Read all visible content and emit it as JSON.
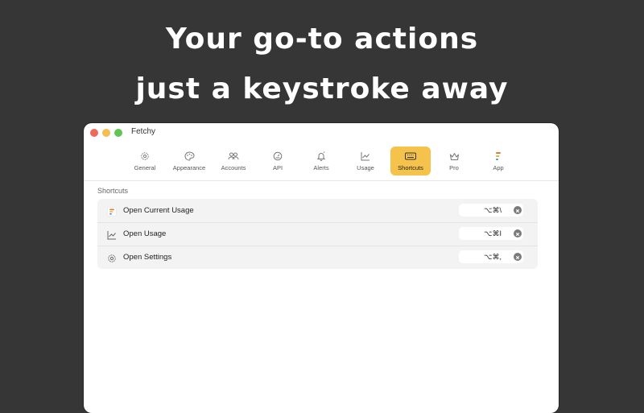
{
  "headline": {
    "line1": "Your go-to actions",
    "line2": "just a keystroke away"
  },
  "window": {
    "title": "Fetchy"
  },
  "tabs": [
    {
      "label": "General",
      "icon": "gear-icon",
      "active": false
    },
    {
      "label": "Appearance",
      "icon": "palette-icon",
      "active": false
    },
    {
      "label": "Accounts",
      "icon": "people-icon",
      "active": false
    },
    {
      "label": "API",
      "icon": "gauge-icon",
      "active": false
    },
    {
      "label": "Alerts",
      "icon": "bell-icon",
      "active": false
    },
    {
      "label": "Usage",
      "icon": "line-chart-icon",
      "active": false
    },
    {
      "label": "Shortcuts",
      "icon": "keyboard-icon",
      "active": true
    },
    {
      "label": "Pro",
      "icon": "crown-icon",
      "active": false
    },
    {
      "label": "App",
      "icon": "app-logo-icon",
      "active": false
    }
  ],
  "section": {
    "title": "Shortcuts"
  },
  "shortcuts": [
    {
      "label": "Open Current Usage",
      "keys": "⌥⌘\\",
      "icon": "app-logo-icon"
    },
    {
      "label": "Open Usage",
      "keys": "⌥⌘I",
      "icon": "line-chart-icon"
    },
    {
      "label": "Open Settings",
      "keys": "⌥⌘,",
      "icon": "gear-icon"
    }
  ],
  "colors": {
    "background": "#363636",
    "accent": "#f5c34b",
    "close": "#ed6a5e",
    "minimize": "#f4bf4f",
    "maximize": "#61c554"
  }
}
